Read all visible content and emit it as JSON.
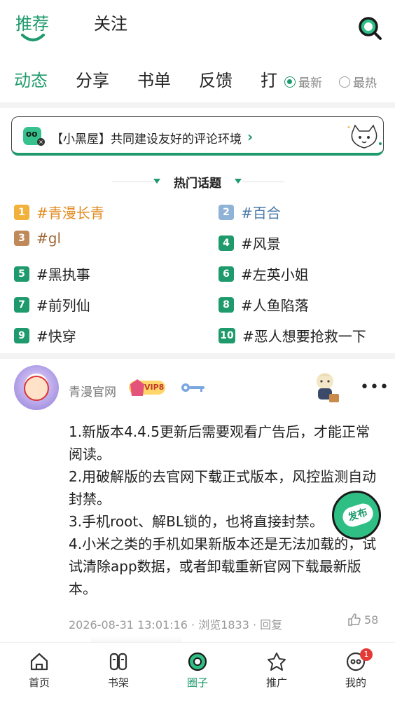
{
  "top_tabs": {
    "recommend": "推荐",
    "follow": "关注"
  },
  "sub_tabs": {
    "items": [
      "动态",
      "分享",
      "书单",
      "反馈",
      "打"
    ],
    "sort_latest": "最新",
    "sort_hot": "最热"
  },
  "notice": {
    "text": "【小黑屋】共同建设友好的评论环境"
  },
  "hot_topics": {
    "title": "热门话题",
    "items": [
      {
        "rank": "1",
        "label": "#青漫长青"
      },
      {
        "rank": "2",
        "label": "#百合"
      },
      {
        "rank": "3",
        "label": "#gl"
      },
      {
        "rank": "4",
        "label": "#风景"
      },
      {
        "rank": "5",
        "label": "#黑执事"
      },
      {
        "rank": "6",
        "label": "#左英小姐"
      },
      {
        "rank": "7",
        "label": "#前列仙"
      },
      {
        "rank": "8",
        "label": "#人鱼陷落"
      },
      {
        "rank": "9",
        "label": "#快穿"
      },
      {
        "rank": "10",
        "label": "#恶人想要抢救一下"
      }
    ]
  },
  "post": {
    "username": "青漫官网",
    "vip_label": "VIP8",
    "lines": [
      "1.新版本4.4.5更新后需要观看广告后，才能正常阅读。",
      "2.用破解版的去官网下载正式版本，风控监测自动封禁。",
      "3.手机root、解BL锁的，也将直接封禁。",
      "4.小米之类的手机如果新版本还是无法加载的，试试清除app数据，或者卸载重新官网下载最新版本。"
    ],
    "meta": "2026-08-31 13:01:16 · 浏览1833 · 回复",
    "likes": "58"
  },
  "fab": {
    "label": "发布"
  },
  "bottom_nav": {
    "home": "首页",
    "shelf": "书架",
    "circle": "圈子",
    "promote": "推广",
    "mine": "我的",
    "mine_badge": "1"
  },
  "colors": {
    "accent": "#1e9a6c",
    "badge_red": "#e53935",
    "rank1": "#f2b13a",
    "rank2": "#8fb3d6",
    "rank3": "#c0895a"
  }
}
